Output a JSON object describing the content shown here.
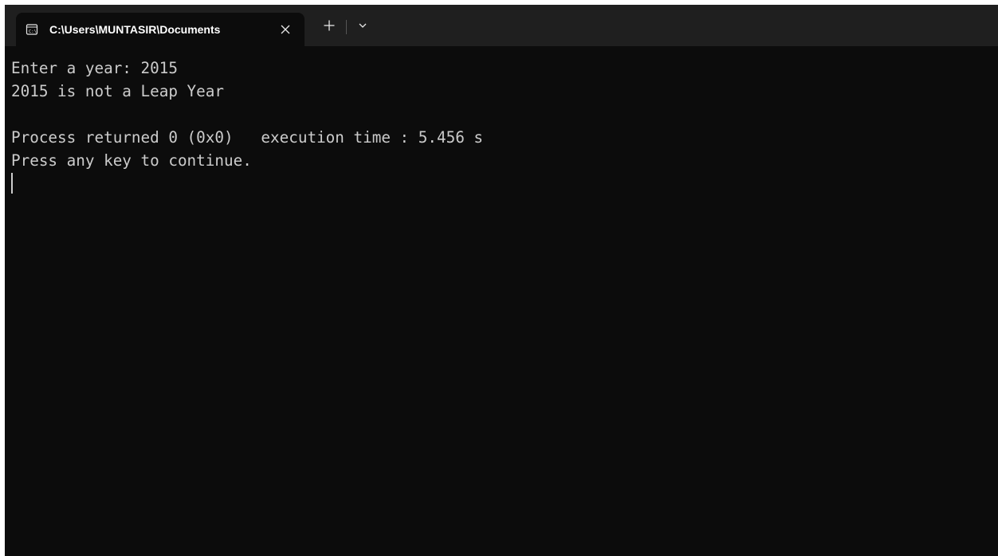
{
  "window": {
    "tab": {
      "icon": "console-icon",
      "title": "C:\\Users\\MUNTASIR\\Documents"
    },
    "buttons": {
      "close": "close-icon",
      "new_tab": "plus-icon",
      "dropdown": "chevron-down-icon"
    }
  },
  "terminal": {
    "lines": [
      "Enter a year: 2015",
      "2015 is not a Leap Year",
      "",
      "Process returned 0 (0x0)   execution time : 5.456 s",
      "Press any key to continue."
    ]
  },
  "colors": {
    "terminal_background": "#0c0c0c",
    "titlebar_background": "#1f1f1f",
    "terminal_text": "#cccccc",
    "tab_text": "#ffffff"
  }
}
